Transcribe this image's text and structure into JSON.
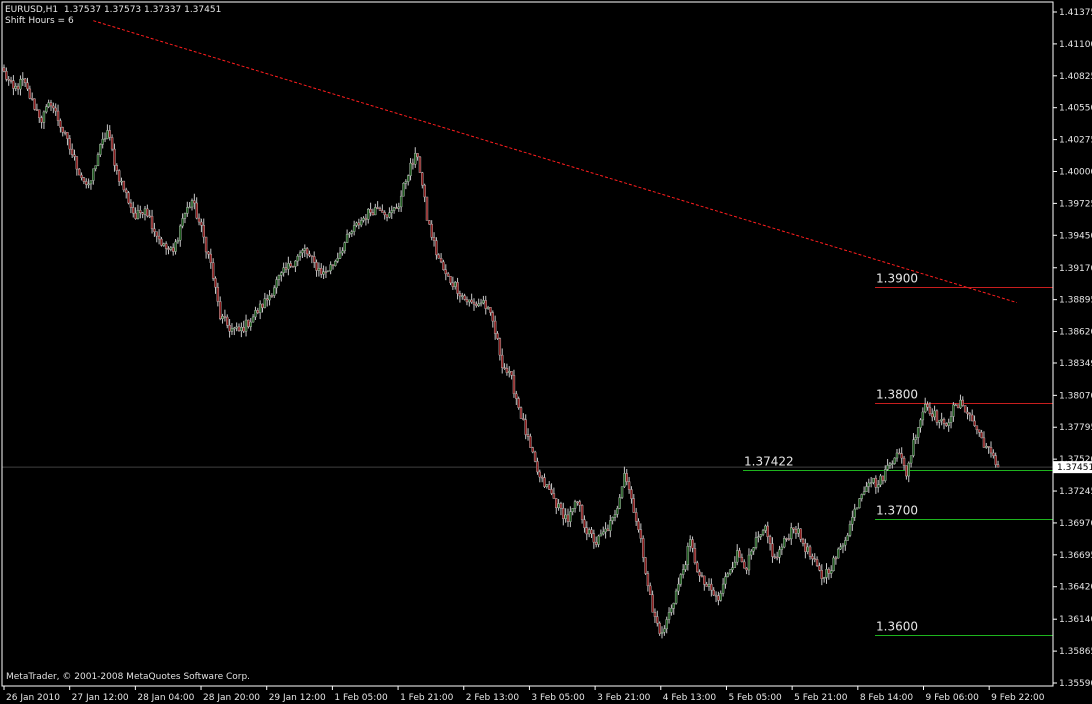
{
  "header": {
    "symbol": "EURUSD,H1",
    "ohlc": "1.37537 1.37573 1.37337 1.37451",
    "shift_label": "Shift Hours = 6"
  },
  "copyright": "MetaTrader, © 2001-2008 MetaQuotes Software Corp.",
  "colors": {
    "background": "#000000",
    "axis": "#ffffff",
    "bull_candle": "#1e5c1e",
    "bear_candle": "#8a1c1c",
    "wick": "#c8c8c8",
    "resistance": "#c81e1e",
    "support": "#1eb41e",
    "trendline": "#ff1e1e",
    "bid_line": "#404040"
  },
  "chart_data": {
    "type": "candlestick",
    "symbol": "EURUSD",
    "timeframe": "H1",
    "y_ticks": [
      "1.41375",
      "1.41100",
      "1.40825",
      "1.40550",
      "1.40275",
      "1.40000",
      "1.39725",
      "1.39450",
      "1.39170",
      "1.38895",
      "1.38620",
      "1.38349",
      "1.38070",
      "1.37795",
      "1.37520",
      "1.37245",
      "1.36970",
      "1.36695",
      "1.36420",
      "1.36140",
      "1.35865",
      "1.35590"
    ],
    "ylim": [
      1.3559,
      1.41375
    ],
    "x_ticks": [
      "26 Jan 2010",
      "27 Jan 12:00",
      "28 Jan 04:00",
      "28 Jan 20:00",
      "29 Jan 12:00",
      "1 Feb 05:00",
      "1 Feb 21:00",
      "2 Feb 13:00",
      "3 Feb 05:00",
      "3 Feb 21:00",
      "4 Feb 13:00",
      "5 Feb 05:00",
      "5 Feb 21:00",
      "8 Feb 14:00",
      "9 Feb 06:00",
      "9 Feb 22:00"
    ],
    "current_price": "1.37451",
    "price_path": [
      [
        0,
        1.4085
      ],
      [
        4,
        1.407
      ],
      [
        8,
        1.4078
      ],
      [
        12,
        1.406
      ],
      [
        16,
        1.4045
      ],
      [
        20,
        1.406
      ],
      [
        24,
        1.404
      ],
      [
        28,
        1.402
      ],
      [
        32,
        1.4
      ],
      [
        36,
        1.3985
      ],
      [
        40,
        1.4015
      ],
      [
        44,
        1.4035
      ],
      [
        48,
        1.4
      ],
      [
        52,
        1.398
      ],
      [
        56,
        1.396
      ],
      [
        60,
        1.397
      ],
      [
        64,
        1.395
      ],
      [
        68,
        1.3935
      ],
      [
        72,
        1.393
      ],
      [
        76,
        1.396
      ],
      [
        80,
        1.3975
      ],
      [
        84,
        1.395
      ],
      [
        88,
        1.392
      ],
      [
        92,
        1.3875
      ],
      [
        96,
        1.3865
      ],
      [
        100,
        1.3862
      ],
      [
        104,
        1.387
      ],
      [
        108,
        1.388
      ],
      [
        112,
        1.389
      ],
      [
        116,
        1.3905
      ],
      [
        120,
        1.3915
      ],
      [
        124,
        1.3925
      ],
      [
        128,
        1.3932
      ],
      [
        132,
        1.392
      ],
      [
        136,
        1.3912
      ],
      [
        140,
        1.392
      ],
      [
        144,
        1.3935
      ],
      [
        148,
        1.3948
      ],
      [
        152,
        1.3958
      ],
      [
        156,
        1.3966
      ],
      [
        160,
        1.397
      ],
      [
        164,
        1.3962
      ],
      [
        168,
        1.3972
      ],
      [
        172,
        1.4
      ],
      [
        176,
        1.4015
      ],
      [
        180,
        1.396
      ],
      [
        184,
        1.393
      ],
      [
        188,
        1.391
      ],
      [
        192,
        1.3902
      ],
      [
        196,
        1.389
      ],
      [
        200,
        1.3885
      ],
      [
        204,
        1.3888
      ],
      [
        208,
        1.387
      ],
      [
        212,
        1.3835
      ],
      [
        216,
        1.382
      ],
      [
        220,
        1.379
      ],
      [
        224,
        1.376
      ],
      [
        228,
        1.3735
      ],
      [
        232,
        1.3725
      ],
      [
        236,
        1.371
      ],
      [
        240,
        1.37
      ],
      [
        244,
        1.3715
      ],
      [
        248,
        1.369
      ],
      [
        252,
        1.368
      ],
      [
        256,
        1.369
      ],
      [
        260,
        1.3702
      ],
      [
        264,
        1.3742
      ],
      [
        268,
        1.371
      ],
      [
        272,
        1.367
      ],
      [
        276,
        1.362
      ],
      [
        280,
        1.36
      ],
      [
        284,
        1.3625
      ],
      [
        288,
        1.365
      ],
      [
        292,
        1.368
      ],
      [
        296,
        1.365
      ],
      [
        300,
        1.364
      ],
      [
        304,
        1.363
      ],
      [
        308,
        1.3655
      ],
      [
        312,
        1.367
      ],
      [
        316,
        1.366
      ],
      [
        320,
        1.368
      ],
      [
        324,
        1.369
      ],
      [
        328,
        1.3665
      ],
      [
        332,
        1.368
      ],
      [
        336,
        1.3695
      ],
      [
        340,
        1.368
      ],
      [
        344,
        1.3665
      ],
      [
        348,
        1.365
      ],
      [
        352,
        1.366
      ],
      [
        356,
        1.3675
      ],
      [
        360,
        1.3695
      ],
      [
        364,
        1.372
      ],
      [
        368,
        1.3735
      ],
      [
        372,
        1.373
      ],
      [
        376,
        1.3745
      ],
      [
        380,
        1.376
      ],
      [
        384,
        1.374
      ],
      [
        388,
        1.3775
      ],
      [
        392,
        1.38
      ],
      [
        396,
        1.379
      ],
      [
        400,
        1.378
      ],
      [
        404,
        1.3795
      ],
      [
        408,
        1.38
      ],
      [
        412,
        1.3785
      ],
      [
        416,
        1.377
      ],
      [
        420,
        1.3755
      ],
      [
        423,
        1.37451
      ]
    ],
    "horizontal_levels": [
      {
        "label": "1.3900",
        "price": 1.39,
        "type": "resistance"
      },
      {
        "label": "1.3800",
        "price": 1.38,
        "type": "resistance"
      },
      {
        "label": "1.37422",
        "price": 1.37422,
        "type": "support"
      },
      {
        "label": "1.3700",
        "price": 1.37,
        "type": "support"
      },
      {
        "label": "1.3600",
        "price": 1.36,
        "type": "support"
      }
    ],
    "trendline": {
      "style": "dashed",
      "from": [
        38,
        1.413
      ],
      "to": [
        431,
        1.3887
      ]
    }
  }
}
